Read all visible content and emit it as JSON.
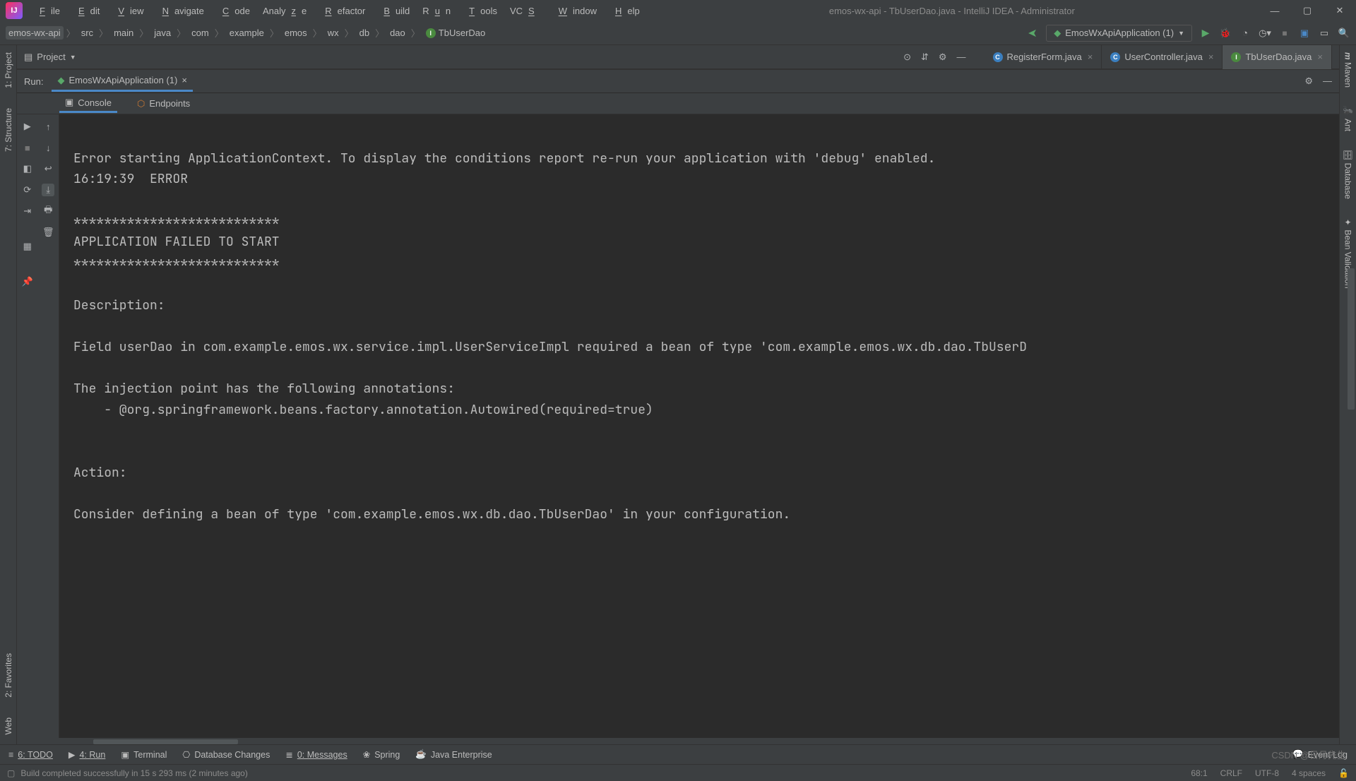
{
  "title": "emos-wx-api - TbUserDao.java - IntelliJ IDEA - Administrator",
  "menu": [
    "File",
    "Edit",
    "View",
    "Navigate",
    "Code",
    "Analyze",
    "Refactor",
    "Build",
    "Run",
    "Tools",
    "VCS",
    "Window",
    "Help"
  ],
  "breadcrumb": [
    "emos-wx-api",
    "src",
    "main",
    "java",
    "com",
    "example",
    "emos",
    "wx",
    "db",
    "dao",
    "TbUserDao"
  ],
  "run_config": "EmosWxApiApplication (1)",
  "project_label": "Project",
  "editor_tabs": [
    {
      "label": "RegisterForm.java",
      "icon": "c"
    },
    {
      "label": "UserController.java",
      "icon": "c"
    },
    {
      "label": "TbUserDao.java",
      "icon": "i",
      "active": true
    }
  ],
  "run_panel": {
    "title": "Run:",
    "tab": "EmosWxApiApplication (1)",
    "subtabs": {
      "console": "Console",
      "endpoints": "Endpoints"
    }
  },
  "left_tabs": {
    "project": "1: Project",
    "structure": "7: Structure",
    "favorites": "2: Favorites",
    "web": "Web"
  },
  "right_tabs": {
    "maven": "Maven",
    "ant": "Ant",
    "database": "Database",
    "bean": "Bean Validation"
  },
  "console_output": "\nError starting ApplicationContext. To display the conditions report re-run your application with 'debug' enabled.\n16:19:39  ERROR\n\n***************************\nAPPLICATION FAILED TO START\n***************************\n\nDescription:\n\nField userDao in com.example.emos.wx.service.impl.UserServiceImpl required a bean of type 'com.example.emos.wx.db.dao.TbUserD\n\nThe injection point has the following annotations:\n    - @org.springframework.beans.factory.annotation.Autowired(required=true)\n\n\nAction:\n\nConsider defining a bean of type 'com.example.emos.wx.db.dao.TbUserDao' in your configuration.\n",
  "bottom_tabs": {
    "todo": "6: TODO",
    "run": "4: Run",
    "terminal": "Terminal",
    "db": "Database Changes",
    "messages": "0: Messages",
    "spring": "Spring",
    "java_ee": "Java Enterprise"
  },
  "event_log": "Event Log",
  "status_msg": "Build completed successfully in 15 s 293 ms (2 minutes ago)",
  "status_right": {
    "pos": "68:1",
    "le": "CRLF",
    "enc": "UTF-8",
    "spaces": "4 spaces"
  },
  "watermark": "CSDN @日月先生"
}
